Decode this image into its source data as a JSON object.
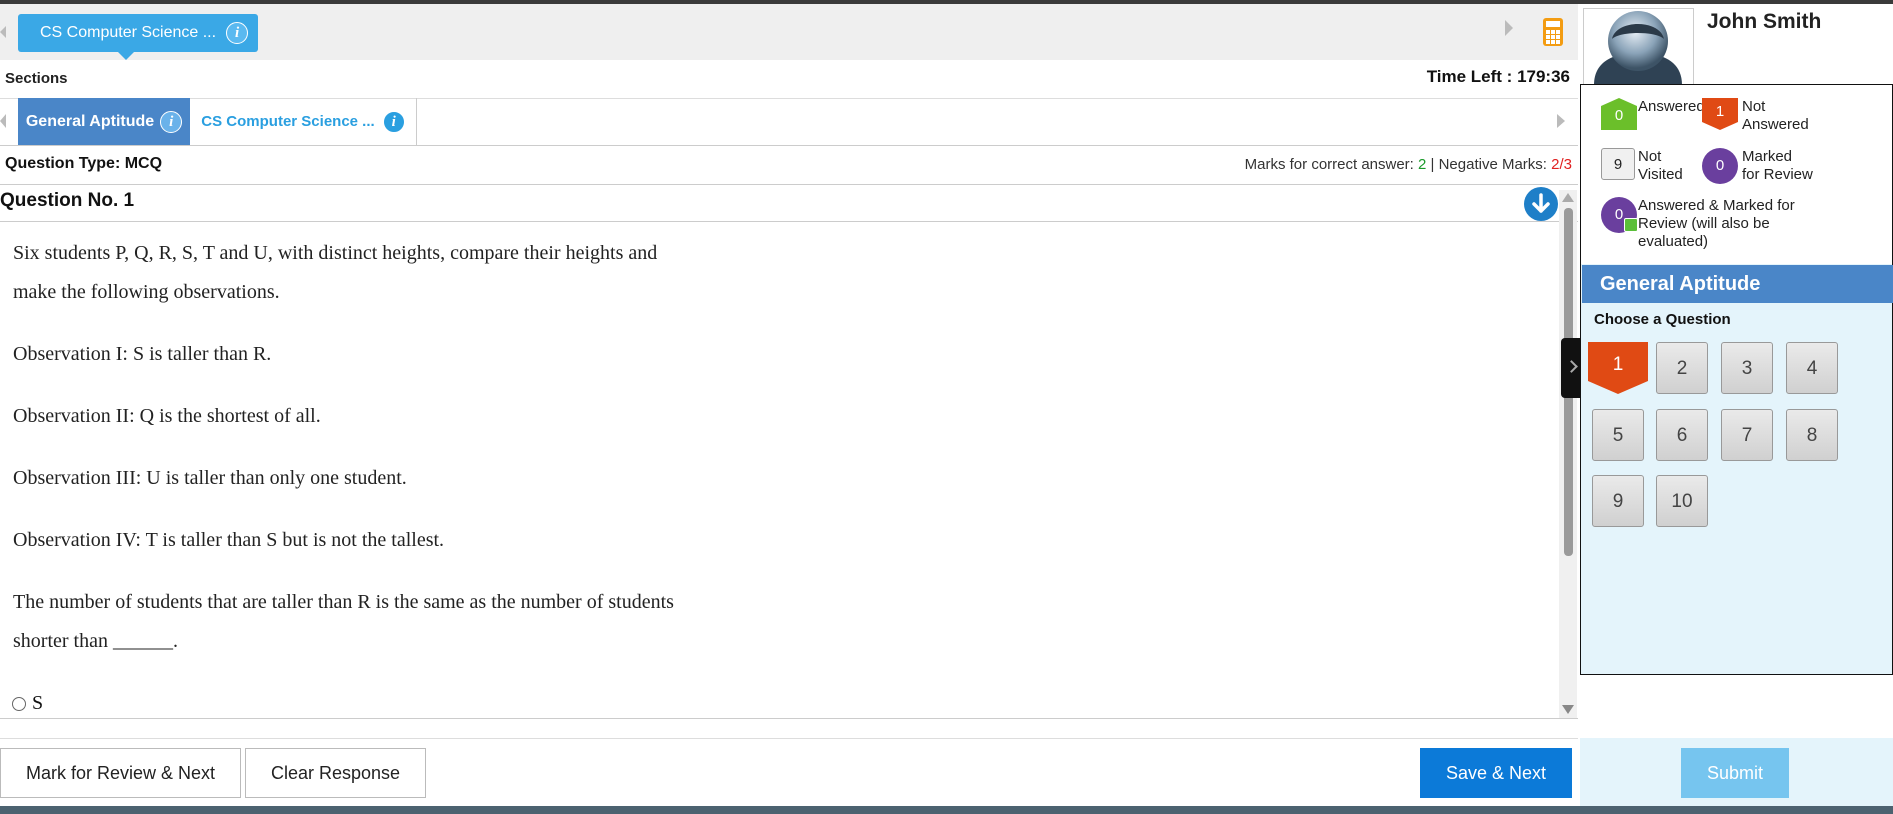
{
  "test_tab": {
    "label": "CS Computer Science ...",
    "info": "i"
  },
  "sections": {
    "label": "Sections",
    "time_left": "Time Left : 179:36"
  },
  "section_tabs": [
    {
      "label": "General Aptitude",
      "info": "i",
      "active": true
    },
    {
      "label": "CS Computer Science ...",
      "info": "i",
      "active": false
    }
  ],
  "question_meta": {
    "type_label": "Question Type: MCQ",
    "marks_prefix": "Marks for correct answer: ",
    "marks_correct": "2",
    "marks_sep": " | Negative Marks: ",
    "marks_negative": "2/3"
  },
  "question": {
    "number_label": "Question No. 1",
    "lines": [
      "Six students P, Q, R, S, T and U, with distinct heights, compare their heights and",
      "make the following observations.",
      "Observation I: S is taller than R.",
      "Observation II: Q is the shortest of all.",
      "Observation III: U is taller than only one student.",
      "Observation IV: T is taller than S but is not the tallest.",
      "The number of students that are taller than R is the same as the number of students",
      "shorter than ______."
    ],
    "options": [
      "S"
    ]
  },
  "buttons": {
    "mark_review": "Mark for Review & Next",
    "clear": "Clear Response",
    "save_next": "Save & Next",
    "submit": "Submit"
  },
  "profile": {
    "name": "John Smith"
  },
  "legend": {
    "answered": {
      "count": "0",
      "label": "Answered"
    },
    "not_answered": {
      "count": "1",
      "label_l1": "Not",
      "label_l2": "Answered"
    },
    "not_visited": {
      "count": "9",
      "label_l1": "Not",
      "label_l2": "Visited"
    },
    "marked": {
      "count": "0",
      "label_l1": "Marked",
      "label_l2": "for Review"
    },
    "answered_marked": {
      "count": "0",
      "label_l1": "Answered & Marked for",
      "label_l2": "Review (will also be",
      "label_l3": "evaluated)"
    }
  },
  "palette": {
    "section_title": "General Aptitude",
    "choose_label": "Choose a Question",
    "questions": [
      "1",
      "2",
      "3",
      "4",
      "5",
      "6",
      "7",
      "8",
      "9",
      "10"
    ],
    "current": "1"
  },
  "colors": {
    "accent_blue": "#4a86c8",
    "save_blue": "#0c7ad8",
    "answered_green": "#6bbf2a",
    "not_answered_red": "#e04a14",
    "marked_purple": "#6a3f9e"
  }
}
